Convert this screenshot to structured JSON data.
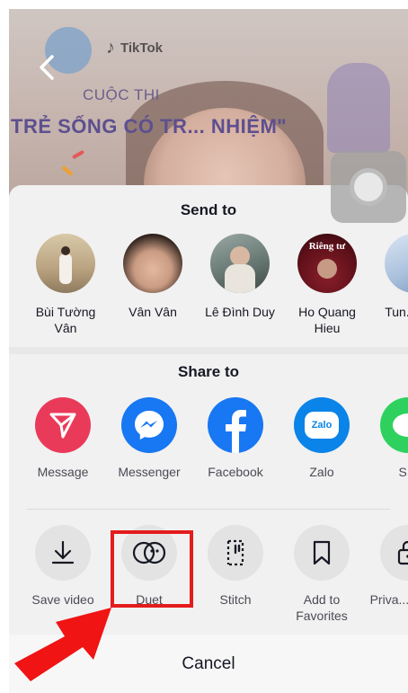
{
  "video": {
    "brand": "TikTok",
    "contest_line1": "CUỘC THI",
    "contest_line2": "TRẺ SỐNG CÓ TR... NHIỆM\""
  },
  "send_to": {
    "title": "Send to",
    "contacts": [
      {
        "name": "Bùi Tường Vân"
      },
      {
        "name": "Vân Vân"
      },
      {
        "name": "Lê Đình Duy"
      },
      {
        "name": "Ho Quang Hieu",
        "avatar_text": "Riêng tư"
      },
      {
        "name": "Tun... Of..."
      }
    ]
  },
  "share_to": {
    "title": "Share to",
    "apps": [
      {
        "label": "Message",
        "icon": "send-icon",
        "color": "#ea3a5a"
      },
      {
        "label": "Messenger",
        "icon": "messenger-icon",
        "color": "#1877f2"
      },
      {
        "label": "Facebook",
        "icon": "facebook-icon",
        "color": "#1877f2"
      },
      {
        "label": "Zalo",
        "icon": "zalo-icon",
        "color": "#0a84e8",
        "icon_text": "Zalo"
      },
      {
        "label": "SM",
        "icon": "sms-icon",
        "color": "#2fd15e"
      }
    ]
  },
  "actions": [
    {
      "label": "Save video",
      "icon": "download-icon"
    },
    {
      "label": "Duet",
      "icon": "duet-icon"
    },
    {
      "label": "Stitch",
      "icon": "stitch-icon"
    },
    {
      "label": "Add to Favorites",
      "icon": "bookmark-icon"
    },
    {
      "label": "Priva... setti...",
      "icon": "lock-icon"
    }
  ],
  "cancel_label": "Cancel",
  "colors": {
    "highlight": "#e41c1c",
    "sheet": "#f1f1f1"
  }
}
